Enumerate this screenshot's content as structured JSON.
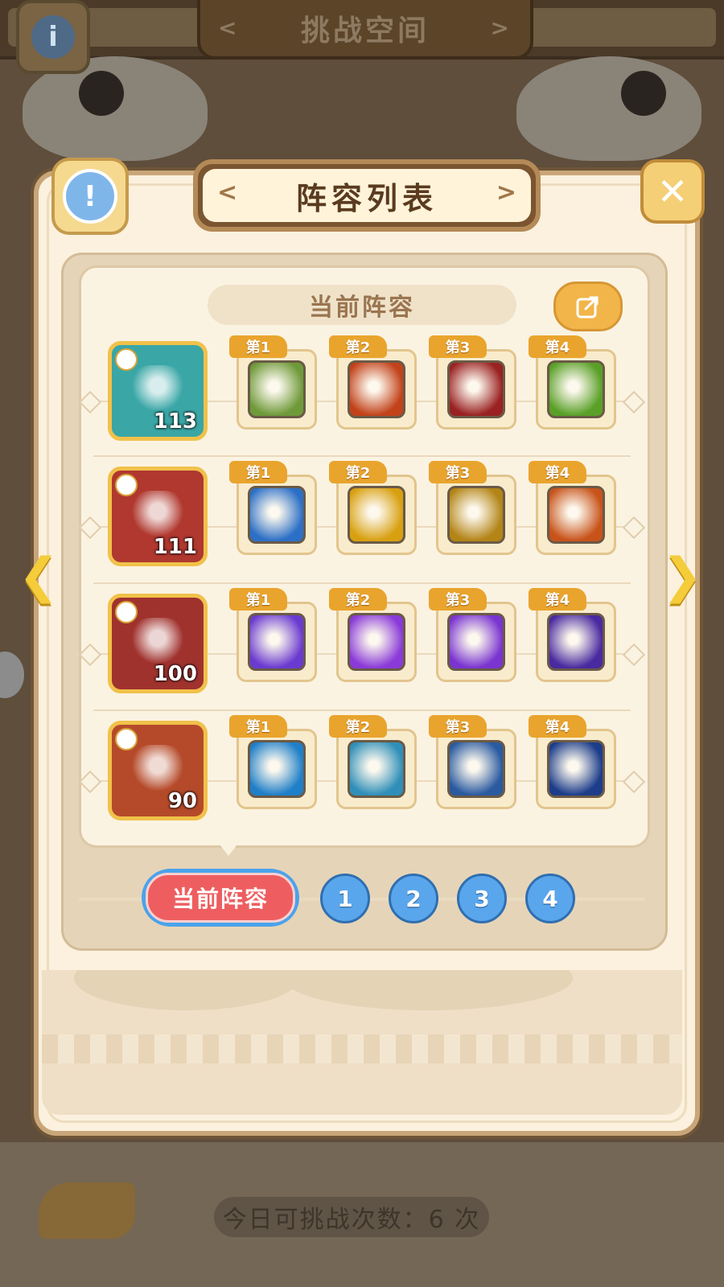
{
  "background": {
    "title": "挑战空间",
    "daily_attempts": "今日可挑战次数：6 次"
  },
  "dialog": {
    "title": "阵容列表",
    "current_label": "当前阵容"
  },
  "lineups": [
    {
      "hero_level": "113",
      "hero_color": "#3aa6a6",
      "skills": [
        {
          "tag": "第1",
          "color": "#6f9a3a"
        },
        {
          "tag": "第2",
          "color": "#c2421a"
        },
        {
          "tag": "第3",
          "color": "#9a2222"
        },
        {
          "tag": "第4",
          "color": "#5aa028"
        }
      ]
    },
    {
      "hero_level": "111",
      "hero_color": "#b0382f",
      "skills": [
        {
          "tag": "第1",
          "color": "#2c6fc6"
        },
        {
          "tag": "第2",
          "color": "#d8a010"
        },
        {
          "tag": "第3",
          "color": "#b38416"
        },
        {
          "tag": "第4",
          "color": "#c8531a"
        }
      ]
    },
    {
      "hero_level": "100",
      "hero_color": "#a0322e",
      "skills": [
        {
          "tag": "第1",
          "color": "#6b3ad0"
        },
        {
          "tag": "第2",
          "color": "#8a3ad8"
        },
        {
          "tag": "第3",
          "color": "#7a34d0"
        },
        {
          "tag": "第4",
          "color": "#4a2aa0"
        }
      ]
    },
    {
      "hero_level": "90",
      "hero_color": "#b54a2a",
      "skills": [
        {
          "tag": "第1",
          "color": "#1f7fc8"
        },
        {
          "tag": "第2",
          "color": "#2f8fb8"
        },
        {
          "tag": "第3",
          "color": "#2a5aa0"
        },
        {
          "tag": "第4",
          "color": "#1c3d8a"
        }
      ]
    }
  ],
  "selector": {
    "current": "当前阵容",
    "slots": [
      "1",
      "2",
      "3",
      "4"
    ]
  }
}
